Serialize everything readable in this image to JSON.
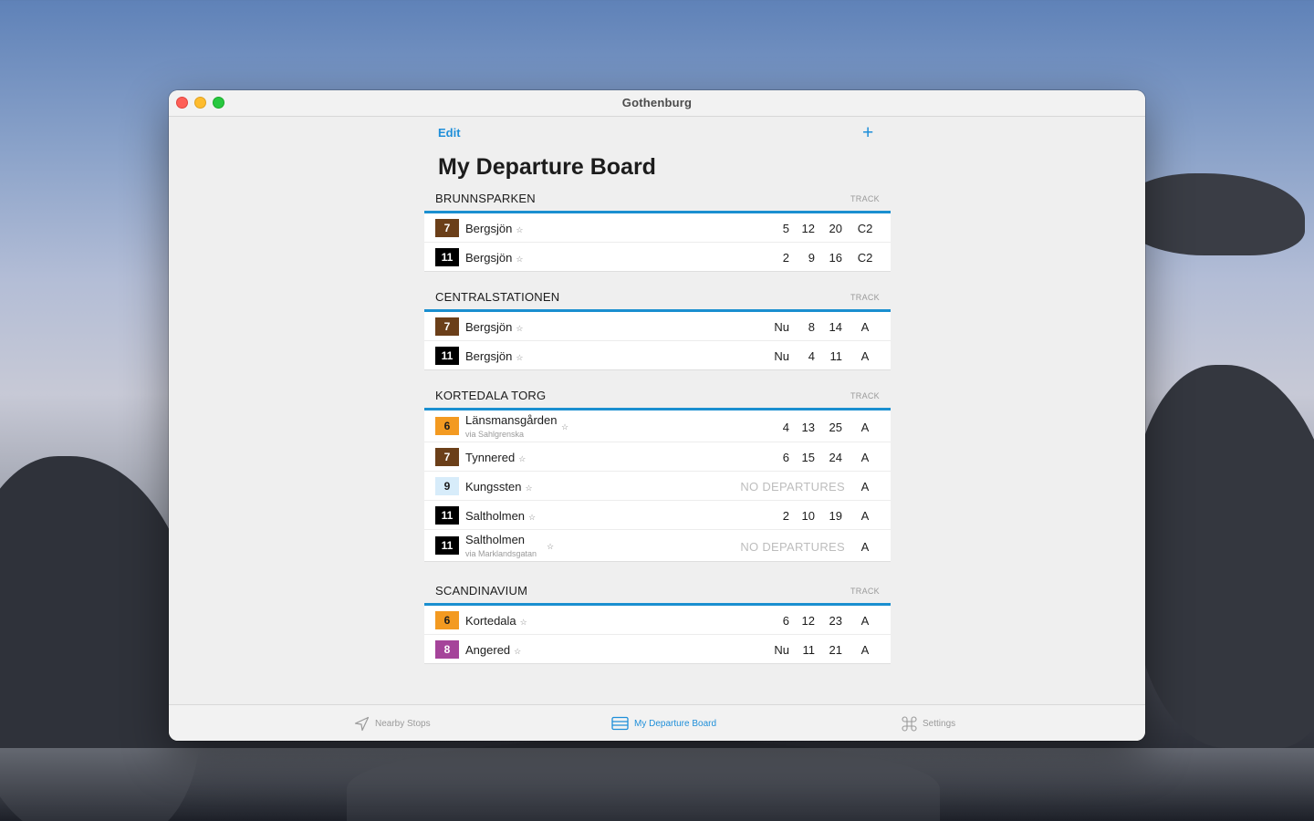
{
  "window": {
    "title": "Gothenburg"
  },
  "toolbar": {
    "edit_label": "Edit",
    "add_label": "+"
  },
  "page": {
    "title": "My Departure Board"
  },
  "colors": {
    "accent": "#1f8fd9",
    "section_rule": "#1a8fd0"
  },
  "sections": [
    {
      "stop": "BRUNNSPARKEN",
      "track_label": "TRACK",
      "rows": [
        {
          "line": "7",
          "badge_bg": "#6b3f19",
          "badge_fg": "#ffffff",
          "destination": "Bergsjön",
          "star": "☆",
          "times": [
            "5",
            "12",
            "20"
          ],
          "track": "C2"
        },
        {
          "line": "11",
          "badge_bg": "#000000",
          "badge_fg": "#ffffff",
          "destination": "Bergsjön",
          "star": "☆",
          "times": [
            "2",
            "9",
            "16"
          ],
          "track": "C2"
        }
      ]
    },
    {
      "stop": "CENTRALSTATIONEN",
      "track_label": "TRACK",
      "rows": [
        {
          "line": "7",
          "badge_bg": "#6b3f19",
          "badge_fg": "#ffffff",
          "destination": "Bergsjön",
          "star": "☆",
          "times": [
            "Nu",
            "8",
            "14"
          ],
          "track": "A"
        },
        {
          "line": "11",
          "badge_bg": "#000000",
          "badge_fg": "#ffffff",
          "destination": "Bergsjön",
          "star": "☆",
          "times": [
            "Nu",
            "4",
            "11"
          ],
          "track": "A"
        }
      ]
    },
    {
      "stop": "KORTEDALA TORG",
      "track_label": "TRACK",
      "rows": [
        {
          "line": "6",
          "badge_bg": "#f39a21",
          "badge_fg": "#1c1c1c",
          "destination": "Länsmansgården",
          "via": "via Sahlgrenska",
          "star": "☆",
          "times": [
            "4",
            "13",
            "25"
          ],
          "track": "A"
        },
        {
          "line": "7",
          "badge_bg": "#6b3f19",
          "badge_fg": "#ffffff",
          "destination": "Tynnered",
          "star": "☆",
          "times": [
            "6",
            "15",
            "24"
          ],
          "track": "A"
        },
        {
          "line": "9",
          "badge_bg": "#d7ecfa",
          "badge_fg": "#1c1c1c",
          "destination": "Kungssten",
          "star": "☆",
          "no_departures": "NO DEPARTURES",
          "track": "A"
        },
        {
          "line": "11",
          "badge_bg": "#000000",
          "badge_fg": "#ffffff",
          "destination": "Saltholmen",
          "star": "☆",
          "times": [
            "2",
            "10",
            "19"
          ],
          "track": "A"
        },
        {
          "line": "11",
          "badge_bg": "#000000",
          "badge_fg": "#ffffff",
          "destination": "Saltholmen",
          "via": "via Marklandsgatan",
          "star": "☆",
          "no_departures": "NO DEPARTURES",
          "track": "A"
        }
      ]
    },
    {
      "stop": "SCANDINAVIUM",
      "track_label": "TRACK",
      "rows": [
        {
          "line": "6",
          "badge_bg": "#f39a21",
          "badge_fg": "#1c1c1c",
          "destination": "Kortedala",
          "star": "☆",
          "times": [
            "6",
            "12",
            "23"
          ],
          "track": "A"
        },
        {
          "line": "8",
          "badge_bg": "#a5449a",
          "badge_fg": "#ffffff",
          "destination": "Angered",
          "star": "☆",
          "times": [
            "Nu",
            "11",
            "21"
          ],
          "track": "A"
        }
      ]
    }
  ],
  "tabbar": {
    "items": [
      {
        "label": "Nearby Stops",
        "icon": "location-arrow-icon",
        "active": false
      },
      {
        "label": "My Departure Board",
        "icon": "board-icon",
        "active": true
      },
      {
        "label": "Settings",
        "icon": "command-icon",
        "active": false
      }
    ]
  }
}
